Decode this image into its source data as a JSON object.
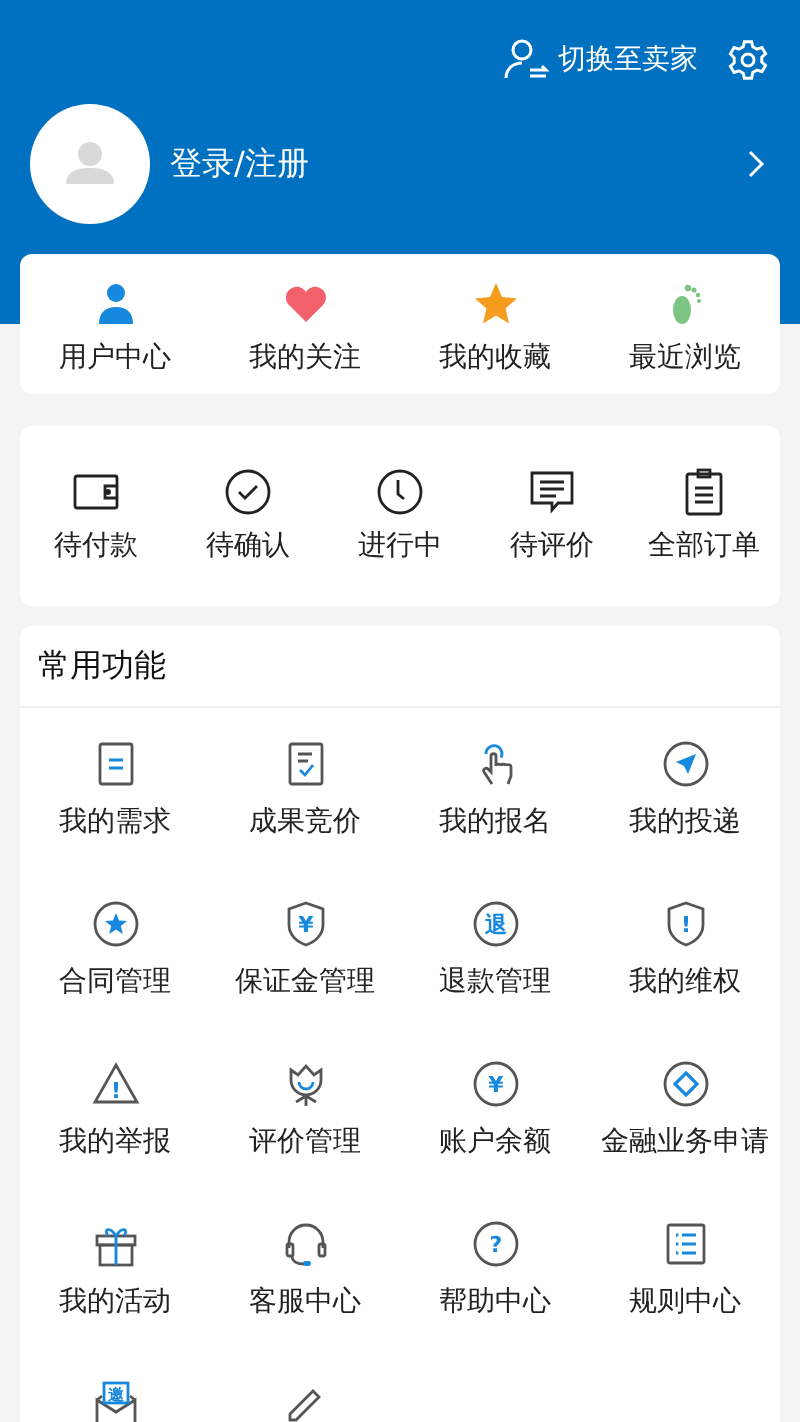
{
  "header": {
    "switch_label": "切换至卖家",
    "login_label": "登录/注册"
  },
  "quick_links": [
    {
      "label": "用户中心",
      "kind": "person"
    },
    {
      "label": "我的关注",
      "kind": "heart"
    },
    {
      "label": "我的收藏",
      "kind": "star"
    },
    {
      "label": "最近浏览",
      "kind": "foot"
    }
  ],
  "orders": [
    {
      "label": "待付款",
      "kind": "wallet"
    },
    {
      "label": "待确认",
      "kind": "check"
    },
    {
      "label": "进行中",
      "kind": "clock"
    },
    {
      "label": "待评价",
      "kind": "comment"
    },
    {
      "label": "全部订单",
      "kind": "clipboard"
    }
  ],
  "functions": {
    "title": "常用功能",
    "items": [
      {
        "label": "我的需求",
        "kind": "doc"
      },
      {
        "label": "成果竞价",
        "kind": "bid"
      },
      {
        "label": "我的报名",
        "kind": "tap"
      },
      {
        "label": "我的投递",
        "kind": "send"
      },
      {
        "label": "合同管理",
        "kind": "starcircle"
      },
      {
        "label": "保证金管理",
        "kind": "shield",
        "glyph": "¥"
      },
      {
        "label": "退款管理",
        "kind": "circle",
        "glyph": "退"
      },
      {
        "label": "我的维权",
        "kind": "shield",
        "glyph": "!"
      },
      {
        "label": "我的举报",
        "kind": "warning",
        "glyph": "!"
      },
      {
        "label": "评价管理",
        "kind": "flower"
      },
      {
        "label": "账户余额",
        "kind": "circle",
        "glyph": "¥"
      },
      {
        "label": "金融业务申请",
        "kind": "diamond"
      },
      {
        "label": "我的活动",
        "kind": "gift"
      },
      {
        "label": "客服中心",
        "kind": "headset"
      },
      {
        "label": "帮助中心",
        "kind": "circle",
        "glyph": "?"
      },
      {
        "label": "规则中心",
        "kind": "list"
      },
      {
        "kind": "invite",
        "glyph": "邀"
      },
      {
        "kind": "pencil"
      }
    ]
  }
}
